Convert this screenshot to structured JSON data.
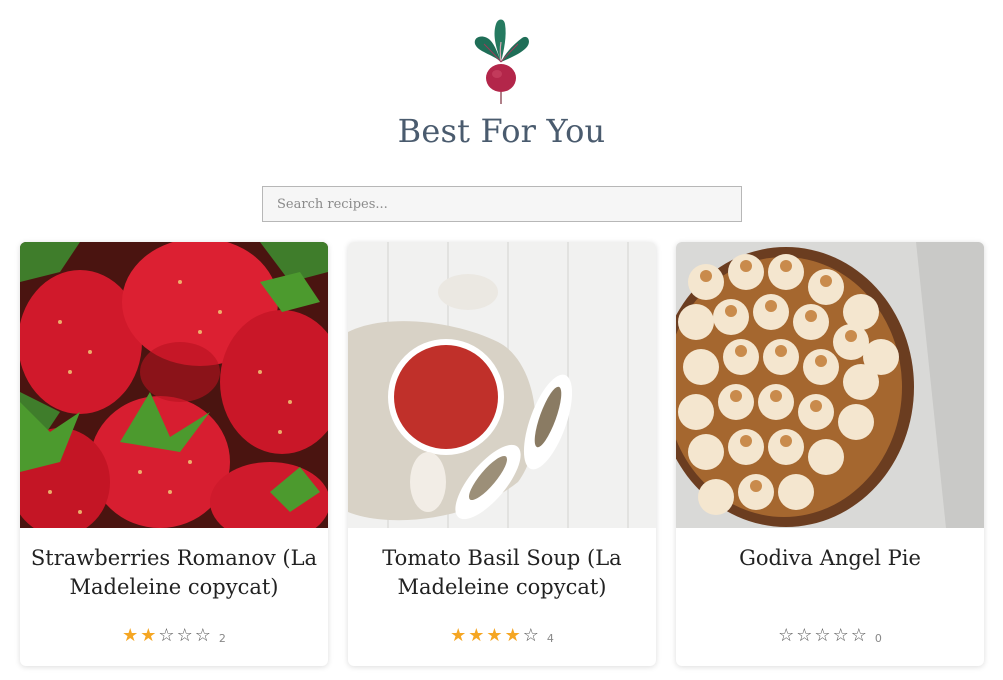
{
  "site": {
    "title": "Best For You"
  },
  "search": {
    "placeholder": "Search recipes..."
  },
  "colors": {
    "star_filled": "#f5a623",
    "star_empty": "#5a5a5a",
    "title": "#4a5b6e"
  },
  "recipes": [
    {
      "title": "Strawberries Romanov (La Madeleine copycat)",
      "rating": 2,
      "rating_max": 5,
      "review_count": "2",
      "image": "strawberries"
    },
    {
      "title": "Tomato Basil Soup (La Madeleine copycat)",
      "rating": 4,
      "rating_max": 5,
      "review_count": "4",
      "image": "tomato-soup"
    },
    {
      "title": "Godiva Angel Pie",
      "rating": 0,
      "rating_max": 5,
      "review_count": "0",
      "image": "meringue-pie"
    }
  ]
}
